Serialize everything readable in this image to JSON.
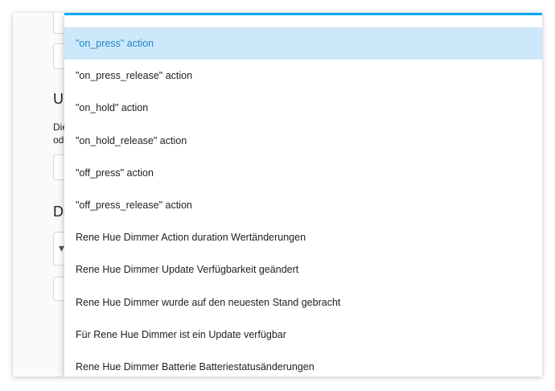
{
  "background": {
    "heading_1": "Un",
    "text_line_1": "Die",
    "text_line_2": "od",
    "heading_2": "Da",
    "arrow_glyph": "▾"
  },
  "dropdown": {
    "accent_color": "#03a9f4",
    "selected_index": 0,
    "items": [
      "\"on_press\" action",
      "\"on_press_release\" action",
      "\"on_hold\" action",
      "\"on_hold_release\" action",
      "\"off_press\" action",
      "\"off_press_release\" action",
      "Rene Hue Dimmer Action duration Wertänderungen",
      "Rene Hue Dimmer Update Verfügbarkeit geändert",
      "Rene Hue Dimmer wurde auf den neuesten Stand gebracht",
      "Für Rene Hue Dimmer ist ein Update verfügbar",
      "Rene Hue Dimmer Batterie Batteriestatusänderungen"
    ]
  }
}
